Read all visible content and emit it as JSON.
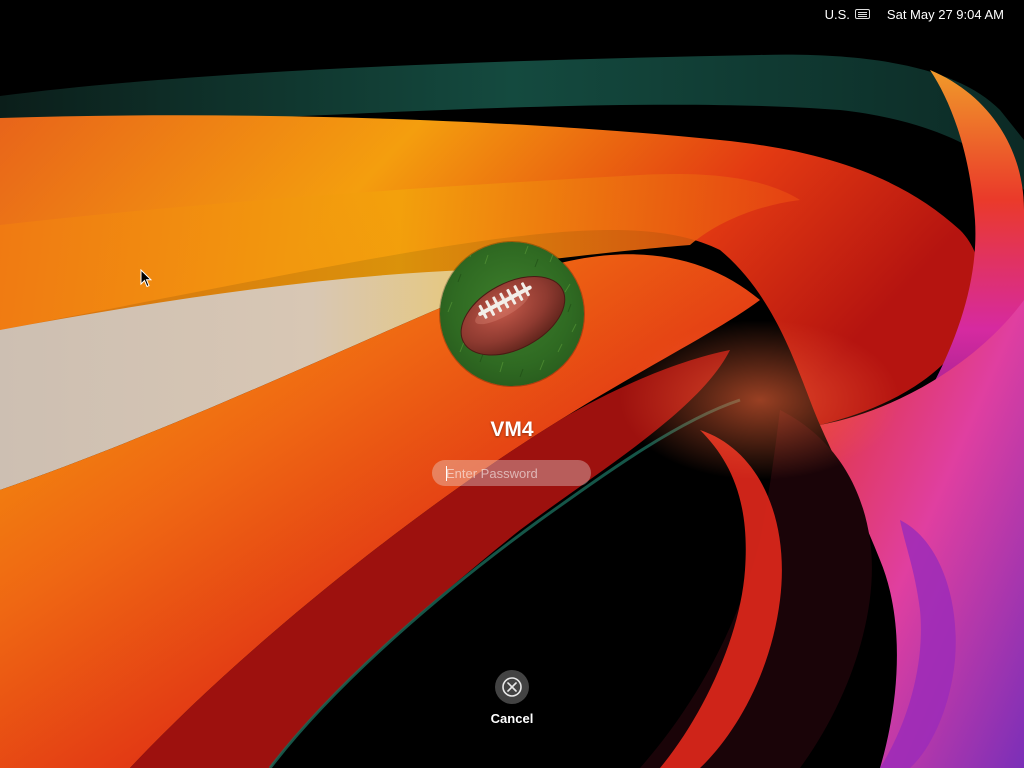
{
  "status_bar": {
    "input_source": "U.S.",
    "input_source_icon": "keyboard-icon",
    "clock": "Sat May 27 9:04 AM"
  },
  "login": {
    "avatar_icon": "football-avatar",
    "username": "VM4",
    "password_value": "",
    "password_placeholder": "Enter Password"
  },
  "cancel": {
    "label": "Cancel",
    "icon": "close-circle-icon"
  },
  "pointer_icon": "mouse-pointer-icon",
  "colors": {
    "background": "#000000",
    "text": "#ffffff",
    "wallpaper_orange": "#f39a0a",
    "wallpaper_red": "#e8201a",
    "wallpaper_teal": "#0e3b33",
    "wallpaper_magenta": "#d22fa8"
  }
}
